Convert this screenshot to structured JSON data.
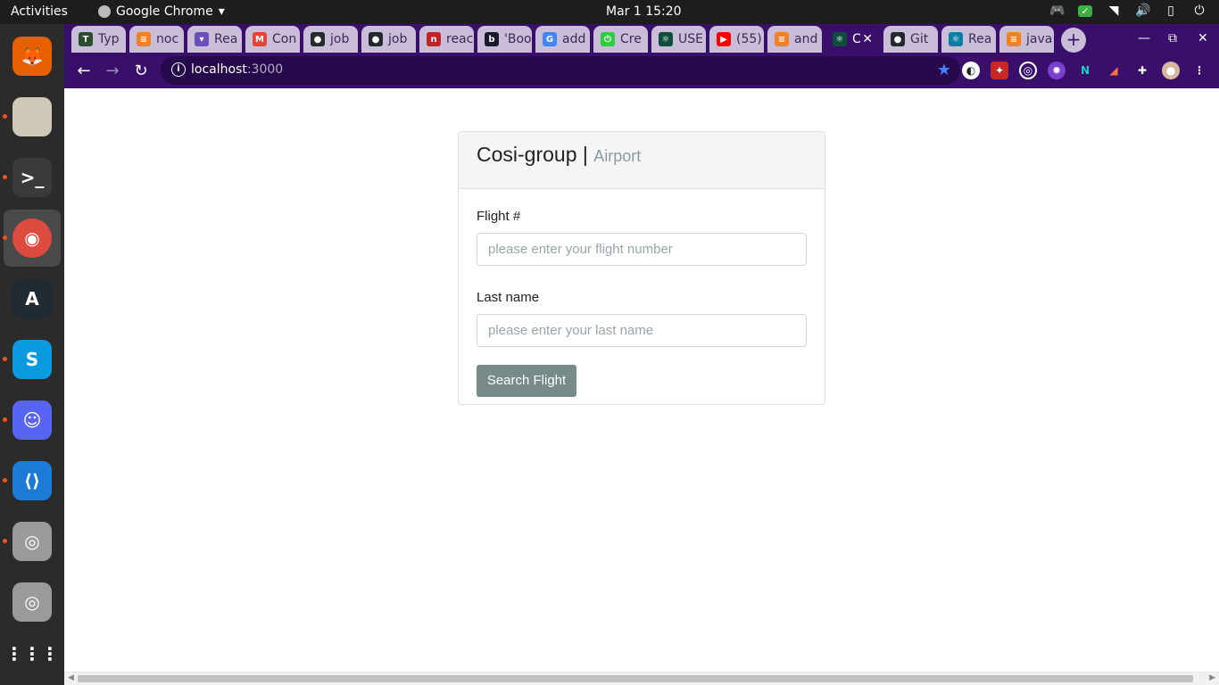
{
  "system": {
    "activities": "Activities",
    "app_name": "Google Chrome",
    "clock": "Mar 1  15:20",
    "tray_icons": [
      "discord-icon",
      "shield-check-icon",
      "wifi-icon",
      "volume-icon",
      "battery-icon",
      "power-icon"
    ]
  },
  "dock": {
    "items": [
      {
        "name": "firefox",
        "color": "#e66000",
        "glyph": "🦊"
      },
      {
        "name": "files",
        "color": "#cfc8b8",
        "glyph": ""
      },
      {
        "name": "terminal",
        "color": "#3a3a3a",
        "glyph": ">_"
      },
      {
        "name": "chrome",
        "color": "#dd4b3e",
        "glyph": "◉"
      },
      {
        "name": "alacritty",
        "color": "#1f2a33",
        "glyph": "A"
      },
      {
        "name": "skype",
        "color": "#0a9ae0",
        "glyph": "S"
      },
      {
        "name": "discord",
        "color": "#5865f2",
        "glyph": "☺"
      },
      {
        "name": "vscode",
        "color": "#1d7bd8",
        "glyph": "⟨⟩"
      },
      {
        "name": "disk-1",
        "color": "#9a9a9a",
        "glyph": "◎"
      },
      {
        "name": "disk-2",
        "color": "#9a9a9a",
        "glyph": "◎"
      },
      {
        "name": "show-apps",
        "color": "#2b2b2b",
        "glyph": "⋮⋮⋮"
      }
    ]
  },
  "tabs": [
    {
      "label": "Typ",
      "fav_color": "#2a4d2e",
      "fav": "T"
    },
    {
      "label": "noc",
      "fav_color": "#f48024",
      "fav": "≡"
    },
    {
      "label": "Rea",
      "fav_color": "#6b4fbb",
      "fav": "▾"
    },
    {
      "label": "Con",
      "fav_color": "#ea4335",
      "fav": "M"
    },
    {
      "label": "job",
      "fav_color": "#24292e",
      "fav": "●"
    },
    {
      "label": "job",
      "fav_color": "#24292e",
      "fav": "●"
    },
    {
      "label": "reac",
      "fav_color": "#c12127",
      "fav": "n"
    },
    {
      "label": "'Boo",
      "fav_color": "#1a1a2e",
      "fav": "b"
    },
    {
      "label": "add",
      "fav_color": "#4285f4",
      "fav": "G"
    },
    {
      "label": "Cre",
      "fav_color": "#2ecc40",
      "fav": "⏻"
    },
    {
      "label": "USE",
      "fav_color": "#0e4d3c",
      "fav": "⚛"
    },
    {
      "label": "(55)",
      "fav_color": "#ff0000",
      "fav": "▶"
    },
    {
      "label": "and",
      "fav_color": "#f48024",
      "fav": "≡"
    },
    {
      "label": "C",
      "fav_color": "#0e4d3c",
      "fav": "⚛"
    },
    {
      "label": "Git",
      "fav_color": "#24292e",
      "fav": "●"
    },
    {
      "label": "Rea",
      "fav_color": "#0a7ea4",
      "fav": "⚛"
    },
    {
      "label": "java",
      "fav_color": "#f48024",
      "fav": "≡"
    }
  ],
  "active_tab_index": 13,
  "address": {
    "host": "localhost",
    "port": ":3000"
  },
  "form": {
    "brand": "Cosi-group",
    "separator": " | ",
    "subtitle": "Airport",
    "flight_label": "Flight #",
    "flight_placeholder": "please enter your flight number",
    "lastname_label": "Last name",
    "lastname_placeholder": "please enter your last name",
    "search_button": "Search Flight"
  },
  "colors": {
    "chrome_frame": "#3a0f6b",
    "button": "#778b8b",
    "header_bg": "#f5f5f5"
  }
}
